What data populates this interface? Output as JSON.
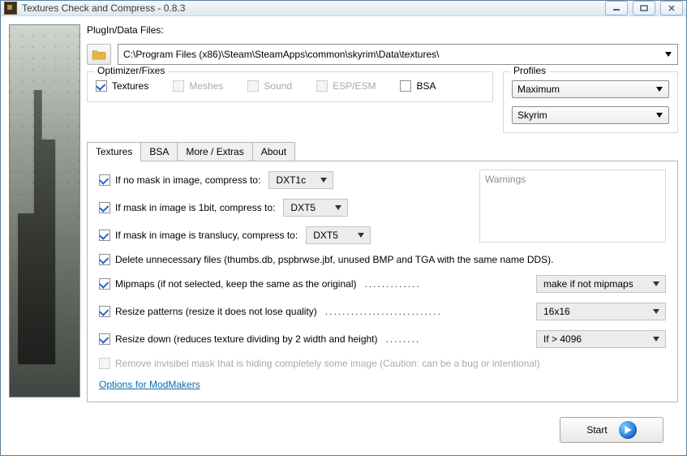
{
  "window": {
    "title": "Textures Check and Compress - 0.8.3"
  },
  "plugin": {
    "label": "PlugIn/Data Files:",
    "path": "C:\\Program Files (x86)\\Steam\\SteamApps\\common\\skyrim\\Data\\textures\\"
  },
  "optimizer": {
    "legend": "Optimizer/Fixes",
    "items": [
      {
        "label": "Textures",
        "checked": true,
        "enabled": true
      },
      {
        "label": "Meshes",
        "checked": false,
        "enabled": false
      },
      {
        "label": "Sound",
        "checked": false,
        "enabled": false
      },
      {
        "label": "ESP/ESM",
        "checked": false,
        "enabled": false
      },
      {
        "label": "BSA",
        "checked": false,
        "enabled": true
      }
    ]
  },
  "profiles": {
    "legend": "Profiles",
    "preset": "Maximum",
    "game": "Skyrim"
  },
  "tabs": [
    "Textures",
    "BSA",
    "More / Extras",
    "About"
  ],
  "activeTab": 0,
  "texturesTab": {
    "warningsLabel": "Warnings",
    "opt_nomask": {
      "label": "If no mask in image, compress to:",
      "value": "DXT1c"
    },
    "opt_1bit": {
      "label": "If mask in image is 1bit, compress to:",
      "value": "DXT5"
    },
    "opt_transl": {
      "label": "If mask in image is translucy, compress to:",
      "value": "DXT5"
    },
    "opt_delete": {
      "label": "Delete unnecessary files (thumbs.db, pspbrwse.jbf, unused BMP and TGA with the same name DDS)."
    },
    "opt_mipmaps": {
      "label": "Mipmaps (if not selected, keep the same as the original)",
      "value": "make if not mipmaps"
    },
    "opt_patterns": {
      "label": "Resize patterns (resize it does not lose quality)",
      "value": "16x16"
    },
    "opt_resize": {
      "label": "Resize down (reduces texture dividing by 2 width and height)",
      "value": "If > 4096"
    },
    "opt_invmask": {
      "label": "Remove invisibel mask that is hiding completely some image (Caution: can be a bug or intentional)",
      "enabled": false
    },
    "optionsLink": "Options for ModMakers"
  },
  "footer": {
    "start": "Start"
  }
}
